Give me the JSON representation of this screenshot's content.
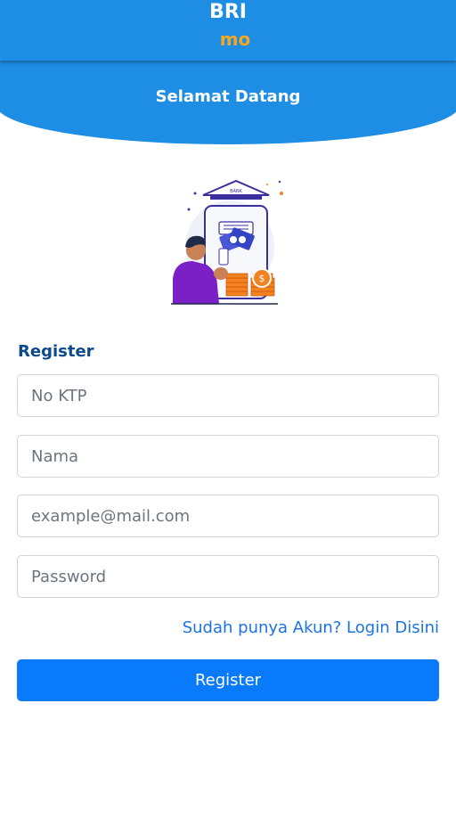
{
  "header": {
    "brand_line1": "BRI",
    "brand_line2": "mo",
    "welcome": "Selamat Datang"
  },
  "illustration": {
    "bank_label": "BANK",
    "icon": "bank-mobile-illustration"
  },
  "form": {
    "title": "Register",
    "fields": {
      "ktp_placeholder": "No KTP",
      "name_placeholder": "Nama",
      "email_placeholder": "example@mail.com",
      "password_placeholder": "Password"
    },
    "login_link": "Sudah punya Akun? Login Disini",
    "submit": "Register"
  },
  "colors": {
    "primary": "#1e8de4",
    "accent": "#f5a623",
    "button": "#0a7afc",
    "title": "#0c4a8b",
    "link": "#1a73e8"
  }
}
